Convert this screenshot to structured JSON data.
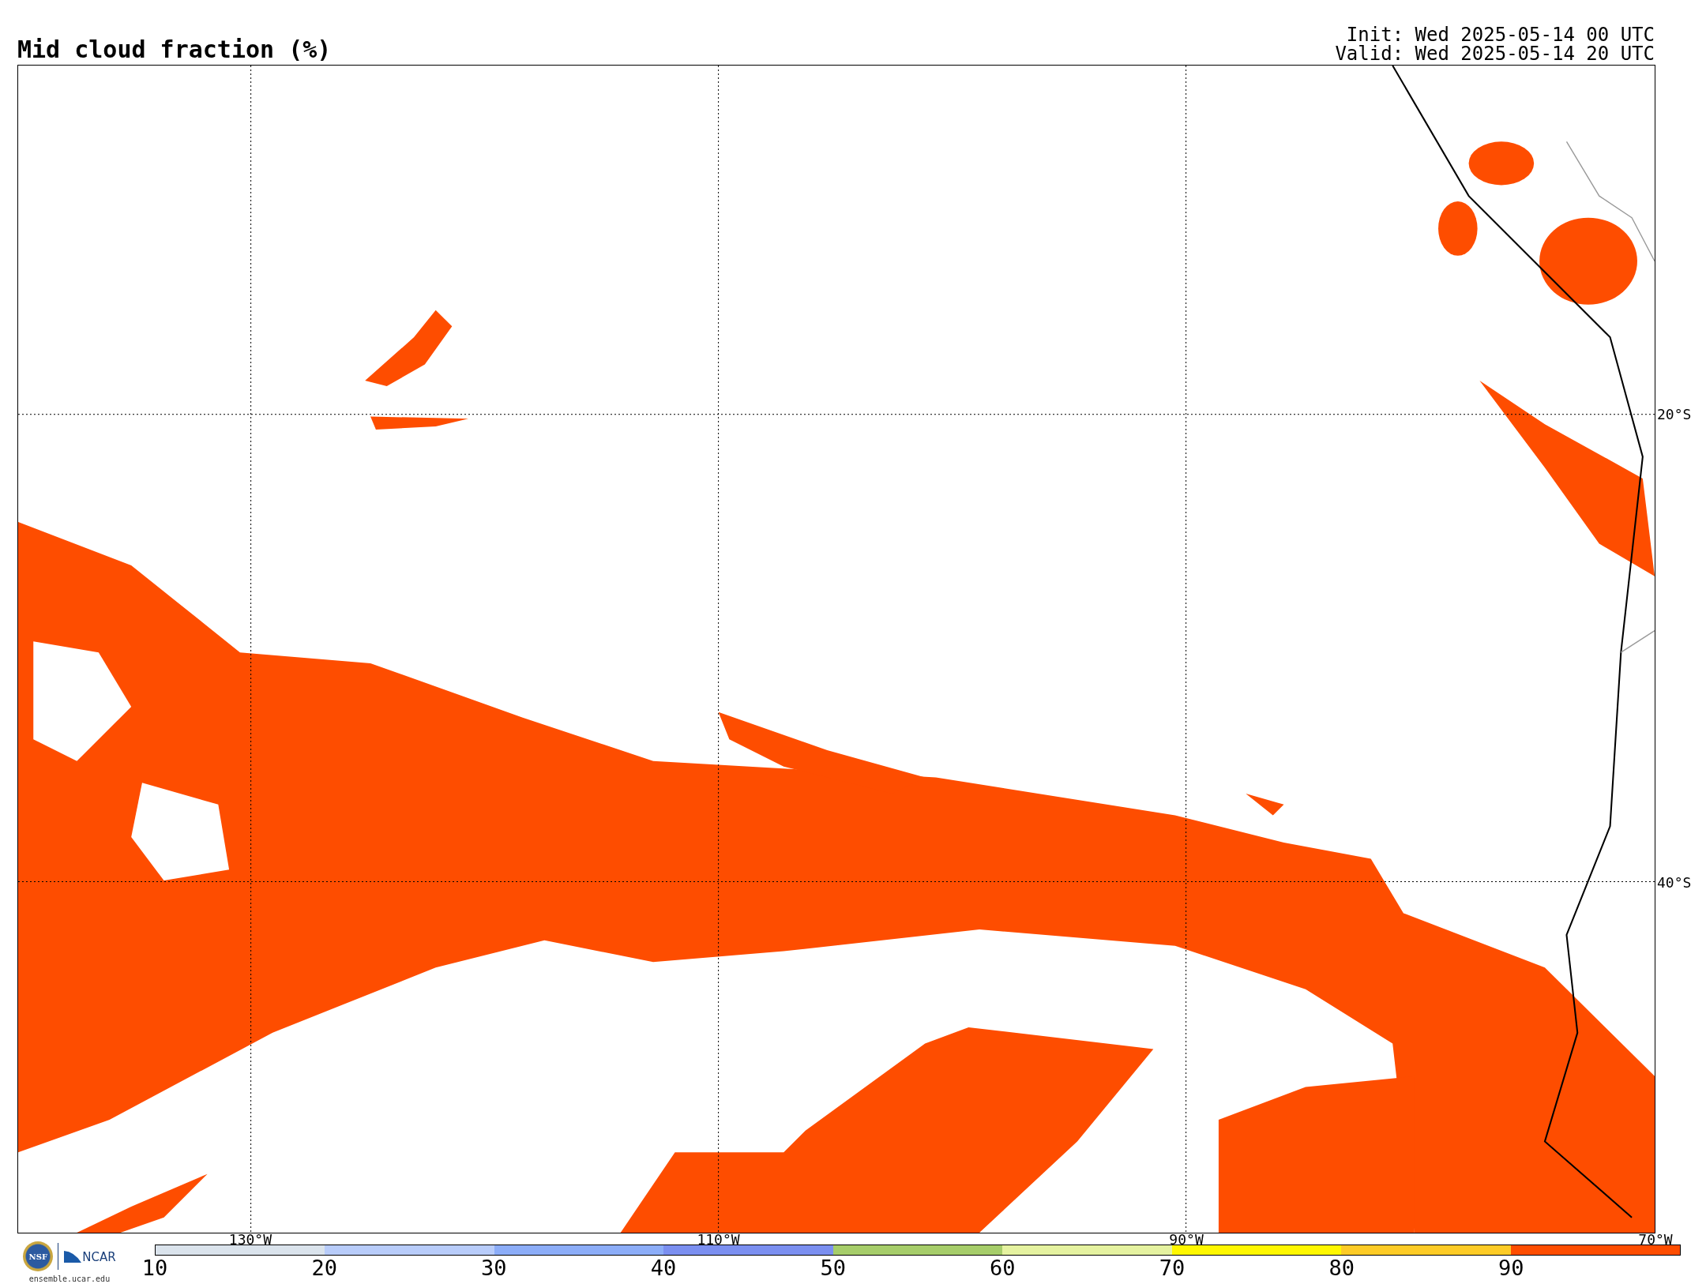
{
  "title": "Mid cloud fraction (%)",
  "run_info": {
    "init": "Init: Wed 2025-05-14 00 UTC",
    "valid": "Valid: Wed 2025-05-14 20 UTC"
  },
  "map": {
    "latitude_labels": [
      "20°S",
      "40°S"
    ],
    "longitude_labels": [
      "130°W",
      "110°W",
      "90°W",
      "70°W"
    ]
  },
  "branding": {
    "seal_text": "NSF",
    "name": "NCAR",
    "url": "ensemble.ucar.edu"
  },
  "colorbar": {
    "segments": [
      {
        "color": "#dae3ec"
      },
      {
        "color": "#b8ccfa"
      },
      {
        "color": "#8cadf8"
      },
      {
        "color": "#7b8ff0"
      },
      {
        "color": "#a6cd6a"
      },
      {
        "color": "#e5f2a0"
      },
      {
        "color": "#fff700"
      },
      {
        "color": "#fdcb26"
      },
      {
        "color": "#fe4d00"
      }
    ],
    "ticks": [
      "10",
      "20",
      "30",
      "40",
      "50",
      "60",
      "70",
      "80",
      "90"
    ]
  }
}
